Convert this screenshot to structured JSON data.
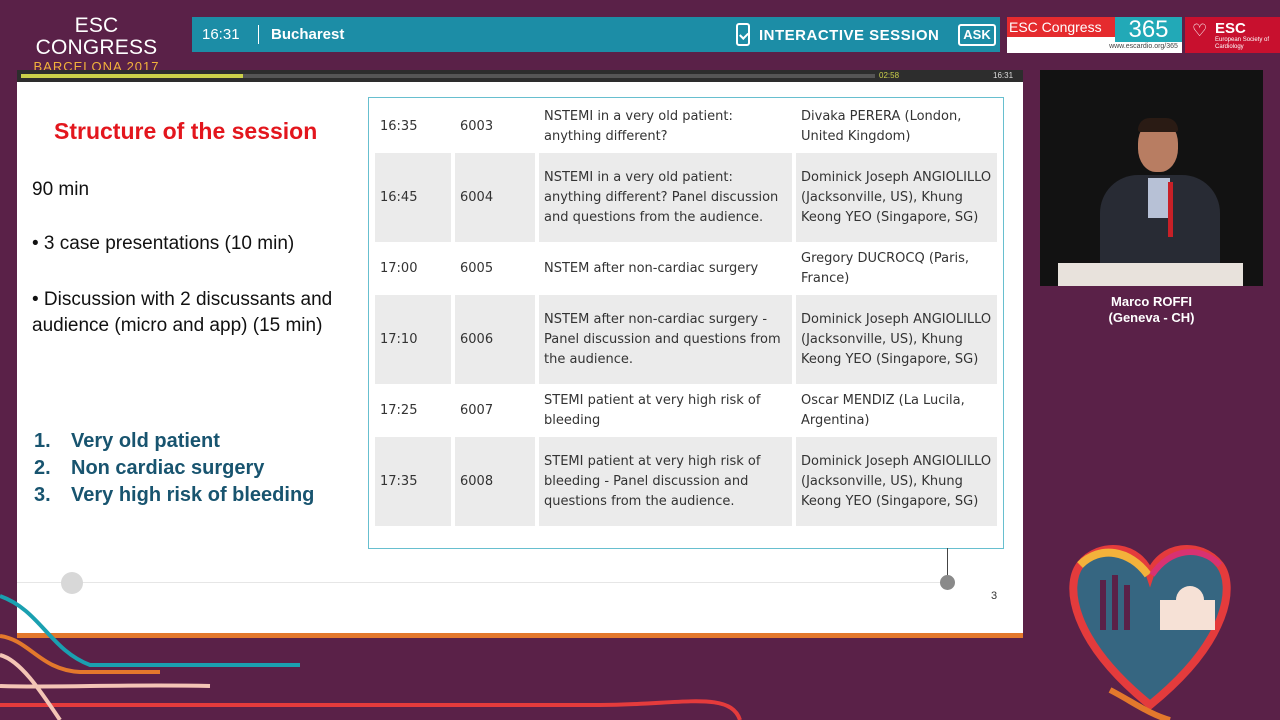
{
  "header": {
    "logo_line1": "ESC CONGRESS",
    "logo_line2": "BARCELONA 2017",
    "time": "16:31",
    "city": "Bucharest",
    "session_label": "INTERACTIVE SESSION",
    "ask_label": "ASK",
    "congress365": "ESC Congress",
    "congress365_num": "365",
    "congress365_url": "www.escardio.org/365",
    "esc_title": "ESC",
    "esc_subtitle": "European Society of Cardiology"
  },
  "player": {
    "progress_fraction": 0.26,
    "remaining": "02:58",
    "clock": "16:31"
  },
  "slide": {
    "title": "Structure of the session",
    "duration": "90 min",
    "bullet1": "• 3 case presentations (10  min)",
    "bullet2": "• Discussion with 2 discussants and audience (micro and app) (15 min)",
    "cases": [
      {
        "num": "1.",
        "label": "Very old patient"
      },
      {
        "num": "2.",
        "label": "Non cardiac surgery"
      },
      {
        "num": "3.",
        "label": "Very high risk of bleeding"
      }
    ],
    "page_number": "3",
    "schedule": [
      {
        "time": "16:35",
        "code": "6003",
        "title": "NSTEMI in a very old patient: anything different?",
        "speaker": "Divaka PERERA (London, United Kingdom)"
      },
      {
        "time": "16:45",
        "code": "6004",
        "title": "NSTEMI in a very old patient: anything different? Panel discussion and questions from the audience.",
        "speaker": "Dominick Joseph ANGIOLILLO (Jacksonville, US), Khung Keong YEO (Singapore, SG)"
      },
      {
        "time": "17:00",
        "code": "6005",
        "title": "NSTEM after non-cardiac surgery",
        "speaker": "Gregory DUCROCQ (Paris, France)"
      },
      {
        "time": "17:10",
        "code": "6006",
        "title": "NSTEM after non-cardiac surgery - Panel discussion and questions from the audience.",
        "speaker": "Dominick Joseph ANGIOLILLO (Jacksonville, US), Khung Keong YEO (Singapore, SG)"
      },
      {
        "time": "17:25",
        "code": "6007",
        "title": "STEMI patient at very high risk of bleeding",
        "speaker": "Oscar MENDIZ (La Lucila, Argentina)"
      },
      {
        "time": "17:35",
        "code": "6008",
        "title": "STEMI patient at very high risk of bleeding - Panel discussion and questions from the audience.",
        "speaker": "Dominick Joseph ANGIOLILLO (Jacksonville, US), Khung Keong YEO (Singapore, SG)"
      }
    ]
  },
  "speaker": {
    "name": "Marco ROFFI",
    "location": "(Geneva - CH)"
  },
  "colors": {
    "background": "#5a2148",
    "accent_teal": "#1c8da6",
    "title_red": "#e3161d",
    "list_blue": "#18546f",
    "esc_red": "#c8102e"
  }
}
